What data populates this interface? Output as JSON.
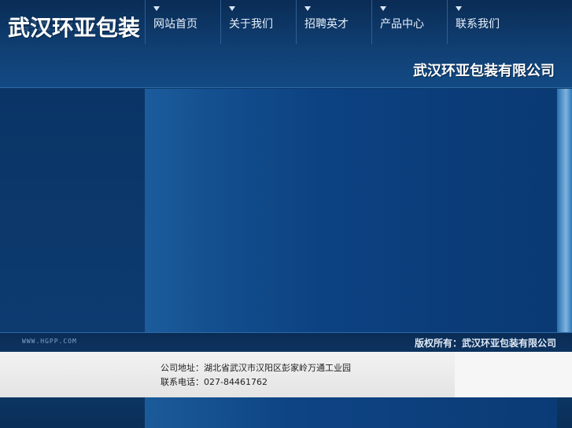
{
  "brand": {
    "logo_text": "武汉环亚包装",
    "company_name": "武汉环亚包装有限公司"
  },
  "nav": {
    "items": [
      {
        "label": "网站首页"
      },
      {
        "label": "关于我们"
      },
      {
        "label": "招聘英才"
      },
      {
        "label": "产品中心"
      },
      {
        "label": "联系我们"
      }
    ]
  },
  "footer": {
    "site_url": "WWW.HGPP.COM",
    "copyright": "版权所有：武汉环亚包装有限公司",
    "address": "公司地址：湖北省武汉市汉阳区彭家岭万通工业园",
    "phone": "联系电话：027-84461762"
  },
  "colors": {
    "background": "#0d3a6a",
    "info_bar": "#e8e8e8"
  }
}
